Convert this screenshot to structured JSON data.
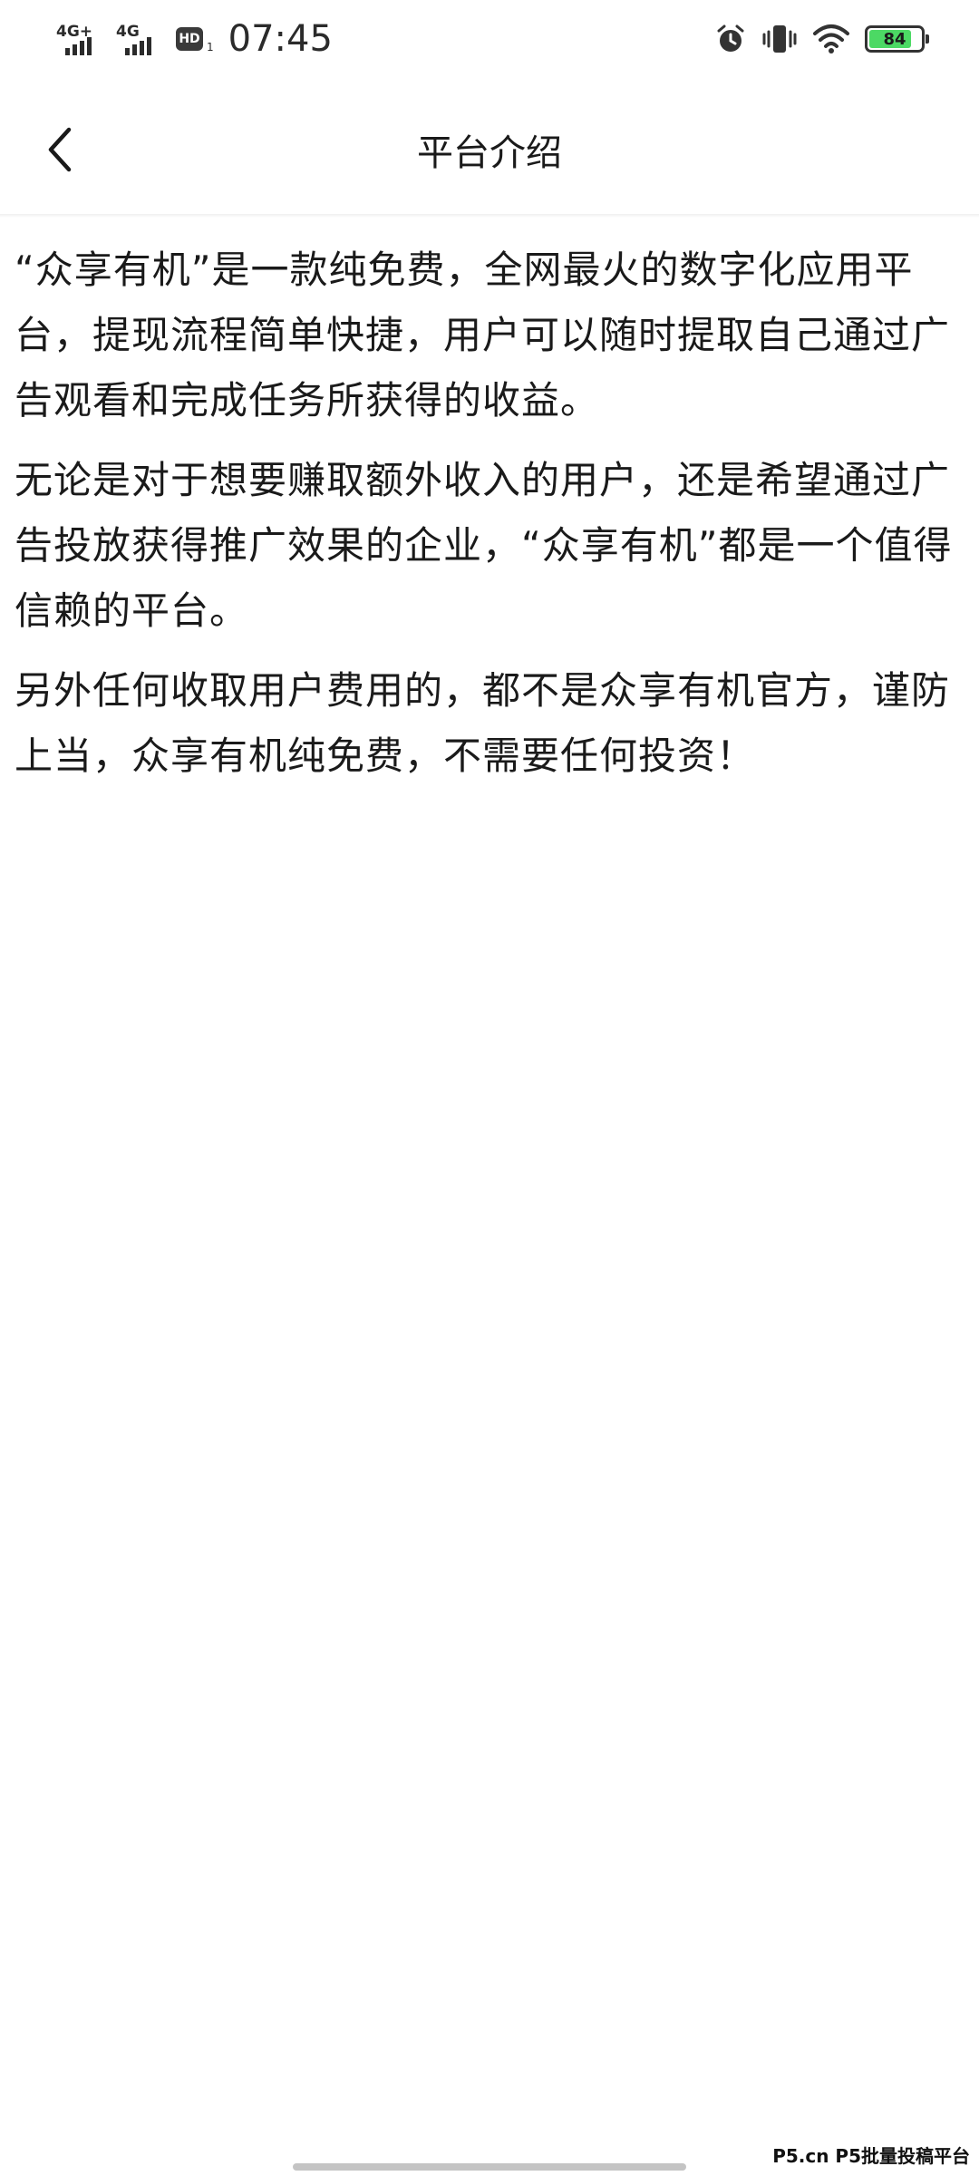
{
  "status_bar": {
    "network1": "4G+",
    "network2": "4G",
    "hd_label": "HD",
    "hd_sub": "1",
    "time": "07:45",
    "battery": "84",
    "battery_level": 0.84,
    "icons": [
      "alarm-icon",
      "vibrate-icon",
      "wifi-icon",
      "battery-icon"
    ]
  },
  "header": {
    "title": "平台介绍",
    "back_icon": "chevron-left-icon"
  },
  "content": {
    "paragraphs": [
      "“众享有机”是一款纯免费，全网最火的数字化应用平台，提现流程简单快捷，用户可以随时提取自己通过广告观看和完成任务所获得的收益。",
      "无论是对于想要赚取额外收入的用户，还是希望通过广告投放获得推广效果的企业，“众享有机”都是一个值得信赖的平台。",
      "另外任何收取用户费用的，都不是众享有机官方，谨防上当，众享有机纯免费，不需要任何投资！"
    ]
  },
  "watermark": "P5.cn P5批量投稿平台",
  "colors": {
    "background": "#ffffff",
    "text": "#1a1a1a",
    "battery_fill": "#4cd964"
  }
}
